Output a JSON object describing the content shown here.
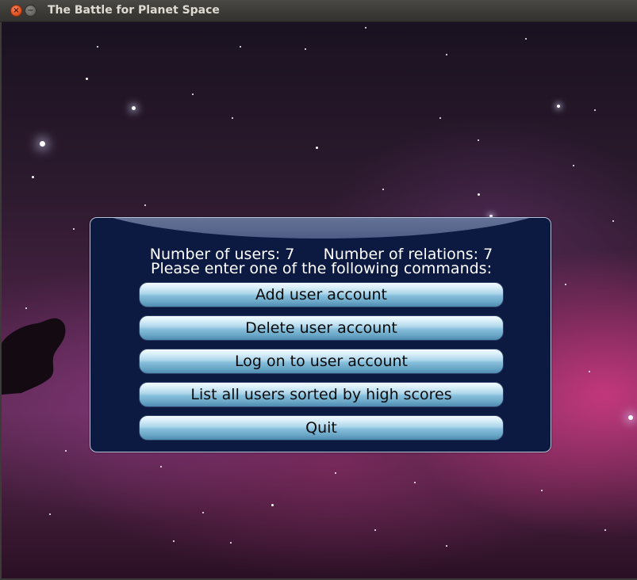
{
  "window": {
    "title": "The Battle for Planet Space",
    "close_glyph": "×",
    "minimize_glyph": "−"
  },
  "menu": {
    "users_label": "Number of users: 7",
    "relations_label": "Number of relations: 7",
    "prompt": "Please enter one of the following commands:",
    "buttons": [
      "Add user account",
      "Delete user account",
      "Log on to user account",
      "List all users sorted by high scores",
      "Quit"
    ]
  },
  "colors": {
    "panel": "#0c1940",
    "button_top": "#f4fbff",
    "button_bottom": "#4f8bb0",
    "close_button": "#e2511f"
  }
}
